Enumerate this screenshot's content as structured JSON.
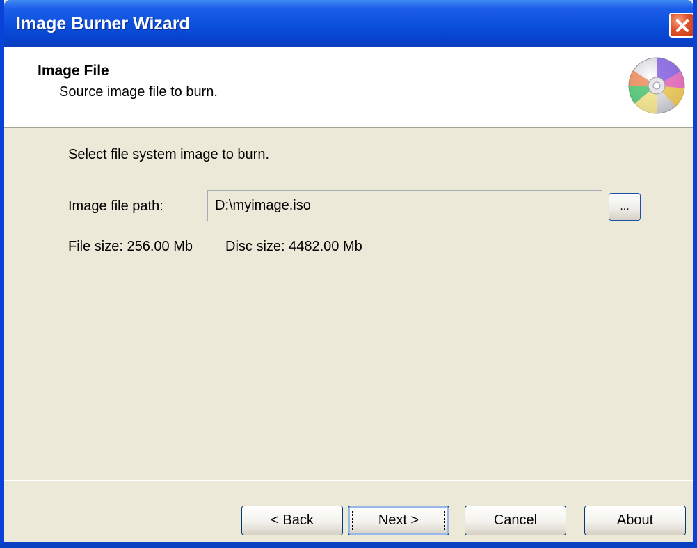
{
  "window": {
    "title": "Image Burner Wizard"
  },
  "header": {
    "title": "Image File",
    "subtitle": "Source image file to burn.",
    "icon": "disc-icon"
  },
  "content": {
    "instruction": "Select file system image to burn.",
    "path_label": "Image file path:",
    "path_value": "D:\\myimage.iso",
    "browse_label": "...",
    "file_size": "File size: 256.00 Mb",
    "disc_size": "Disc size: 4482.00 Mb"
  },
  "buttons": {
    "back": "< Back",
    "next": "Next >",
    "cancel": "Cancel",
    "about": "About"
  },
  "colors": {
    "titlebar": "#0a4fdc",
    "close": "#e2532a",
    "dialog_bg": "#ece9d8"
  }
}
